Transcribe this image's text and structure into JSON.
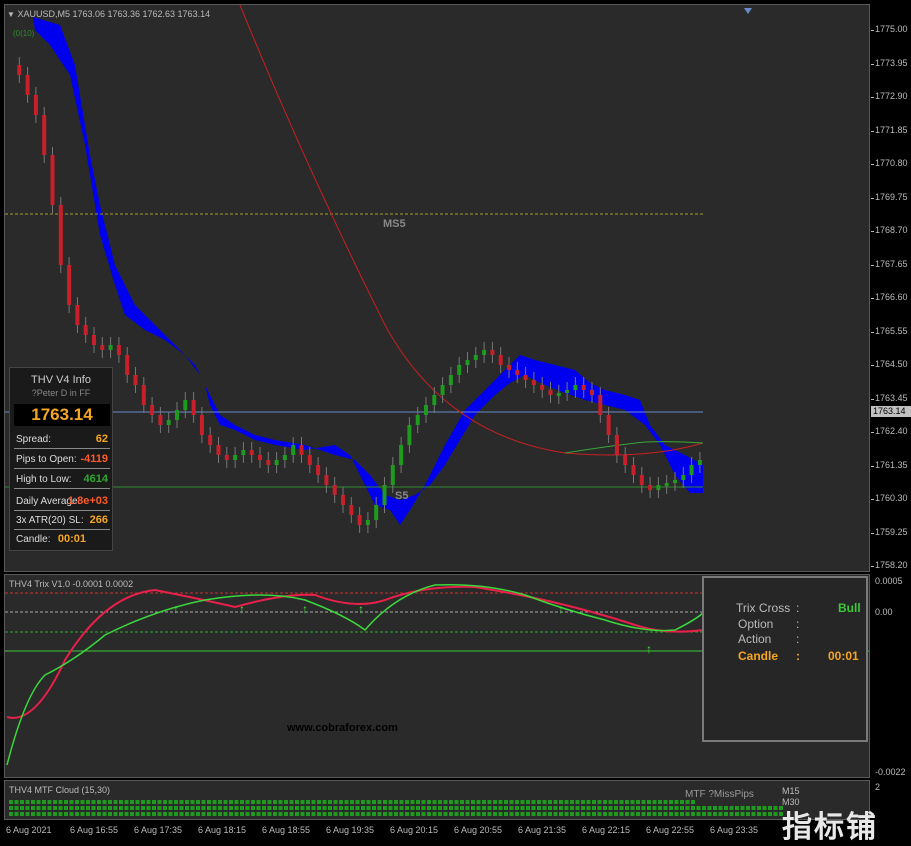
{
  "main": {
    "symbol_header": "XAUUSD,M5  1763.06 1763.36 1762.63 1763.14",
    "indicator_header": "(0(10)",
    "current_price_label": "1763.14",
    "ms5_label": "MS5",
    "s5_label": "S5",
    "price_scale": [
      "1775.00",
      "1773.95",
      "1772.90",
      "1771.85",
      "1770.80",
      "1769.75",
      "1768.70",
      "1767.65",
      "1766.60",
      "1765.55",
      "1764.50",
      "1763.45",
      "1762.40",
      "1761.35",
      "1760.30",
      "1759.25",
      "1758.20"
    ],
    "colors": {
      "bull": "#1e9a1e",
      "bear": "#c8202a",
      "cloud": "#0000ee",
      "ma_red": "#c82020",
      "hline_blue": "#6a8ac8",
      "hline_green": "#2e8b2e"
    }
  },
  "info_panel": {
    "title": "THV  V4  Info",
    "subtitle": "?Peter D in FF",
    "price": "1763.14",
    "rows": [
      {
        "label": "Spread:",
        "value": "62"
      },
      {
        "label": "Pips to Open:",
        "value": "-4119"
      },
      {
        "label": "High to Low:",
        "value": "4614"
      },
      {
        "label": "Daily Average:",
        "value": "1.8e+03"
      },
      {
        "label": "3x ATR(20) SL:",
        "value": "266"
      },
      {
        "label": "Candle:",
        "value": "00:01"
      }
    ]
  },
  "trix": {
    "header": "THV4 Trix V1.0 -0.0001 0.0002",
    "scale": [
      "0.0005",
      "0.00",
      "-0.0022"
    ],
    "watermark": "www.cobraforex.com",
    "box": {
      "trix_cross_label": "Trix Cross",
      "trix_cross_value": "Bull",
      "option_label": "Option",
      "action_label": "Action",
      "candle_label": "Candle",
      "candle_value": "00:01",
      "colon": ":"
    }
  },
  "cloud": {
    "header": "THV4 MTF Cloud (15,30)",
    "mtf_label": "MTF ?MissPips",
    "tf_labels": [
      "M15",
      "M30"
    ],
    "scale_value": "2"
  },
  "time_axis": [
    "6 Aug 2021",
    "6 Aug 16:55",
    "6 Aug 17:35",
    "6 Aug 18:15",
    "6 Aug 18:55",
    "6 Aug 19:35",
    "6 Aug 20:15",
    "6 Aug 20:55",
    "6 Aug 21:35",
    "6 Aug 22:15",
    "6 Aug 22:55",
    "6 Aug 23:35"
  ],
  "brand_watermark": "指标铺"
}
